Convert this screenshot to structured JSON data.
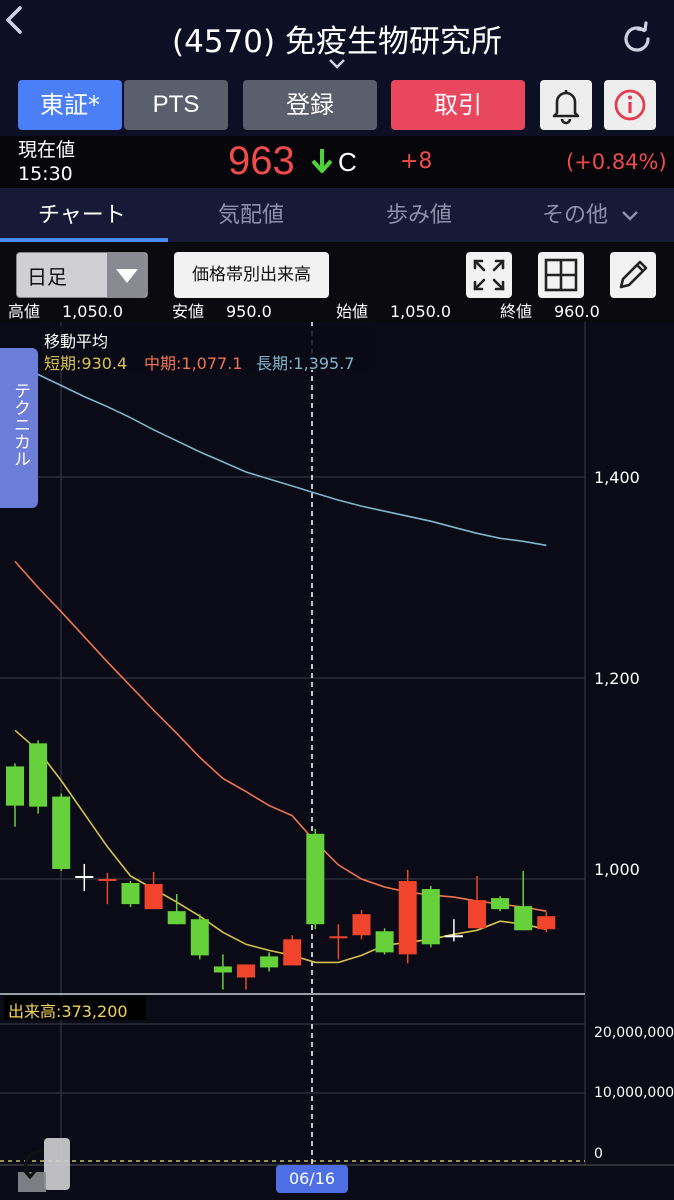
{
  "header": {
    "title": "(4570) 免疫生物研究所",
    "back_icon": "chevron-left-icon",
    "refresh_icon": "refresh-icon"
  },
  "market_buttons": {
    "tosho": "東証*",
    "pts": "PTS",
    "touroku": "登録",
    "torihiki": "取引"
  },
  "quote": {
    "label": "現在値",
    "time": "15:30",
    "price": "963",
    "flag": "C",
    "change": "+8",
    "change_pct": "(+0.84%)"
  },
  "tabs": [
    {
      "label": "チャート",
      "active": true
    },
    {
      "label": "気配値",
      "active": false
    },
    {
      "label": "歩み値",
      "active": false
    },
    {
      "label": "その他",
      "active": false
    }
  ],
  "toolbar": {
    "period": "日足",
    "volume_profile": "価格帯別出来高"
  },
  "ohlc": {
    "high_label": "高値",
    "high": "1,050.0",
    "low_label": "安値",
    "low": "950.0",
    "open_label": "始値",
    "open": "1,050.0",
    "close_label": "終値",
    "close": "960.0"
  },
  "moving_average": {
    "title": "移動平均",
    "short": "短期:930.4",
    "mid": "中期:1,077.1",
    "long": "長期:1,395.7"
  },
  "technical_tab": "テクニカル",
  "volume": {
    "label": "出来高:373,200",
    "ticks": [
      "20,000,000",
      "10,000,000",
      "0"
    ]
  },
  "cursor_date": "06/16",
  "colors": {
    "up": "#f0452c",
    "down": "#66d13a",
    "ma_short": "#d6c24a",
    "ma_mid": "#ef7550",
    "ma_long": "#7fb6c8",
    "accent": "#4b7ff7"
  },
  "chart_data": {
    "type": "candlestick",
    "ylim": [
      880,
      1540
    ],
    "yticks": [
      1000,
      1200,
      1400
    ],
    "candles": [
      {
        "o": 1112,
        "c": 1073,
        "h": 1115,
        "l": 1052,
        "color": "down"
      },
      {
        "o": 1135,
        "c": 1072,
        "h": 1138,
        "l": 1065,
        "color": "down"
      },
      {
        "o": 1082,
        "c": 1010,
        "h": 1085,
        "l": 1008,
        "color": "down"
      },
      {
        "o": 1003,
        "c": 1003,
        "h": 1015,
        "l": 988,
        "color": "doji"
      },
      {
        "o": 1000,
        "c": 1000,
        "h": 1006,
        "l": 975,
        "color": "up"
      },
      {
        "o": 996,
        "c": 975,
        "h": 998,
        "l": 972,
        "color": "down"
      },
      {
        "o": 970,
        "c": 995,
        "h": 1007,
        "l": 970,
        "color": "up"
      },
      {
        "o": 968,
        "c": 955,
        "h": 985,
        "l": 955,
        "color": "down"
      },
      {
        "o": 960,
        "c": 924,
        "h": 965,
        "l": 920,
        "color": "down"
      },
      {
        "o": 913,
        "c": 907,
        "h": 925,
        "l": 890,
        "color": "down"
      },
      {
        "o": 902,
        "c": 915,
        "h": 915,
        "l": 890,
        "color": "up"
      },
      {
        "o": 923,
        "c": 912,
        "h": 927,
        "l": 908,
        "color": "down"
      },
      {
        "o": 914,
        "c": 940,
        "h": 944,
        "l": 914,
        "color": "up"
      },
      {
        "o": 1045,
        "c": 955,
        "h": 1050,
        "l": 950,
        "color": "down"
      },
      {
        "o": 943,
        "c": 943,
        "h": 955,
        "l": 920,
        "color": "up"
      },
      {
        "o": 944,
        "c": 965,
        "h": 969,
        "l": 940,
        "color": "up"
      },
      {
        "o": 948,
        "c": 927,
        "h": 951,
        "l": 925,
        "color": "down"
      },
      {
        "o": 925,
        "c": 998,
        "h": 1009,
        "l": 916,
        "color": "up"
      },
      {
        "o": 990,
        "c": 935,
        "h": 993,
        "l": 932,
        "color": "down"
      },
      {
        "o": 944,
        "c": 944,
        "h": 960,
        "l": 938,
        "color": "doji"
      },
      {
        "o": 951,
        "c": 979,
        "h": 1003,
        "l": 951,
        "color": "up"
      },
      {
        "o": 970,
        "c": 981,
        "h": 983,
        "l": 968,
        "color": "down"
      },
      {
        "o": 973,
        "c": 949,
        "h": 1008,
        "l": 949,
        "color": "down"
      },
      {
        "o": 950,
        "c": 963,
        "h": 967,
        "l": 947,
        "color": "up"
      }
    ],
    "ma_short": [
      1148,
      1128,
      1098,
      1065,
      1032,
      1003,
      990,
      977,
      963,
      947,
      935,
      929,
      924,
      917,
      917,
      924,
      934,
      937,
      940,
      945,
      949,
      958,
      955,
      950
    ],
    "ma_mid": [
      1316,
      1290,
      1266,
      1241,
      1216,
      1192,
      1168,
      1145,
      1121,
      1100,
      1087,
      1073,
      1063,
      1037,
      1014,
      1000,
      992,
      987,
      984,
      982,
      978,
      975,
      972,
      968
    ],
    "ma_long": [
      1513,
      1502,
      1491,
      1480,
      1470,
      1459,
      1447,
      1436,
      1425,
      1415,
      1405,
      1398,
      1391,
      1384,
      1377,
      1371,
      1366,
      1361,
      1356,
      1350,
      1344,
      1339,
      1336,
      1332
    ]
  }
}
